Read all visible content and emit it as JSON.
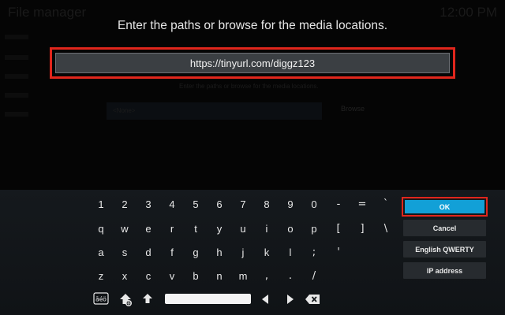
{
  "background": {
    "title": "File manager",
    "clock": "12:00 PM",
    "inner_label": "Enter the paths or browse for the media locations.",
    "field_placeholder": "<None>",
    "browse_label": "Browse"
  },
  "dialog": {
    "heading": "Enter the paths or browse for the media locations.",
    "url_value": "https://tinyurl.com/diggz123"
  },
  "keyboard": {
    "row1": [
      "1",
      "2",
      "3",
      "4",
      "5",
      "6",
      "7",
      "8",
      "9",
      "0",
      "-",
      "=",
      "`"
    ],
    "row2": [
      "q",
      "w",
      "e",
      "r",
      "t",
      "y",
      "u",
      "i",
      "o",
      "p",
      "[",
      "]",
      "\\"
    ],
    "row3": [
      "a",
      "s",
      "d",
      "f",
      "g",
      "h",
      "j",
      "k",
      "l",
      ";",
      "'"
    ],
    "row4": [
      "z",
      "x",
      "c",
      "v",
      "b",
      "n",
      "m",
      ",",
      ".",
      "/"
    ],
    "icons": [
      "accents-icon",
      "globe-icon",
      "shift-icon",
      "space-bar",
      "cursor-left-icon",
      "cursor-right-icon",
      "backspace-icon"
    ]
  },
  "actions": {
    "ok": "OK",
    "cancel": "Cancel",
    "layout": "English QWERTY",
    "ip": "IP address"
  },
  "colors": {
    "highlight_border": "#e1261c",
    "ok_fill": "#12a0d7",
    "button_fill": "#272b2f",
    "panel_fill": "#14181b"
  }
}
